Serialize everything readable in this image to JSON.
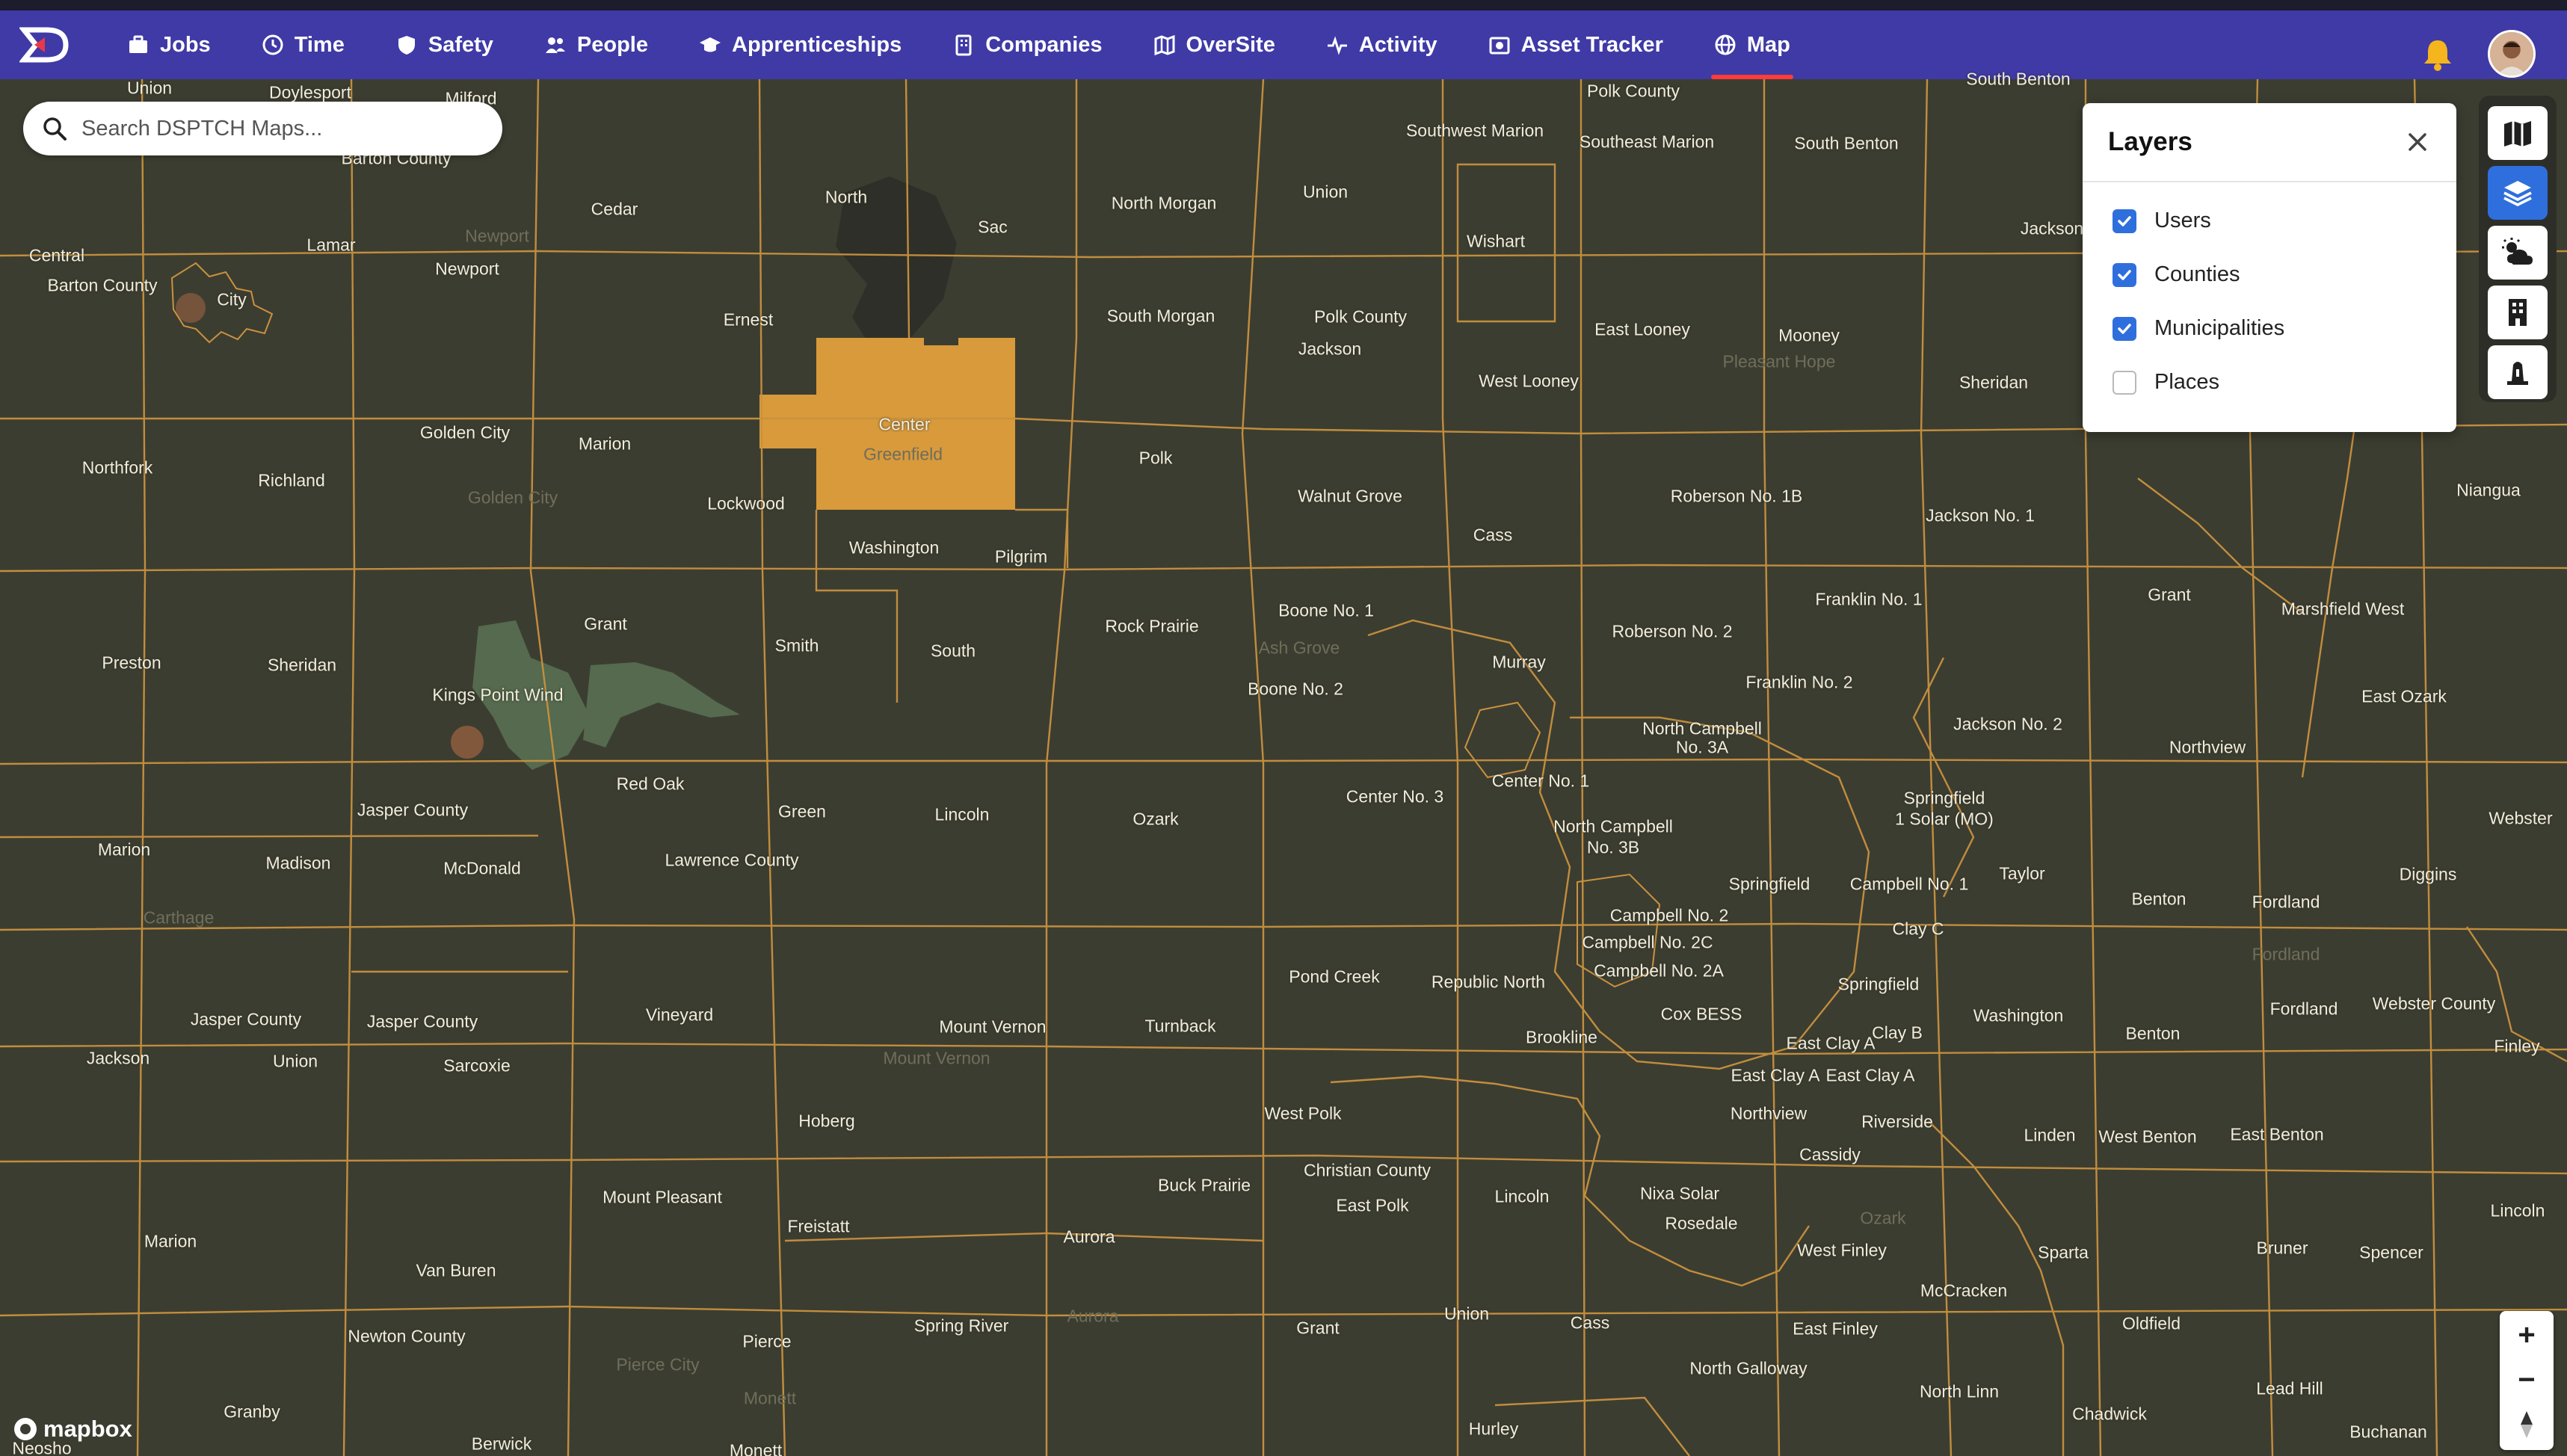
{
  "nav": {
    "items": [
      {
        "label": "Jobs",
        "icon": "briefcase-icon"
      },
      {
        "label": "Time",
        "icon": "clock-icon"
      },
      {
        "label": "Safety",
        "icon": "shield-icon"
      },
      {
        "label": "People",
        "icon": "people-icon"
      },
      {
        "label": "Apprenticeships",
        "icon": "graduation-cap-icon"
      },
      {
        "label": "Companies",
        "icon": "building-icon"
      },
      {
        "label": "OverSite",
        "icon": "map-book-icon"
      },
      {
        "label": "Activity",
        "icon": "pulse-icon"
      },
      {
        "label": "Asset Tracker",
        "icon": "camera-box-icon"
      },
      {
        "label": "Map",
        "icon": "globe-icon",
        "active": true
      }
    ]
  },
  "search": {
    "placeholder": "Search DSPTCH Maps..."
  },
  "layers_panel": {
    "title": "Layers",
    "items": [
      {
        "label": "Users",
        "checked": true
      },
      {
        "label": "Counties",
        "checked": true
      },
      {
        "label": "Municipalities",
        "checked": true
      },
      {
        "label": "Places",
        "checked": false
      }
    ]
  },
  "map": {
    "attribution": "mapbox",
    "colors": {
      "background": "#3c3d31",
      "boundary": "#c9923e",
      "highlight": "#d99a3c",
      "label": "#f1eddc"
    },
    "highlighted_region": "Center",
    "labels": [
      [
        "Union",
        200,
        118
      ],
      [
        "Doylesport",
        415,
        124
      ],
      [
        "Milford",
        630,
        132
      ],
      [
        "Polk County",
        2185,
        122
      ],
      [
        "South Benton",
        2700,
        106
      ],
      [
        "Barton County",
        530,
        212
      ],
      [
        "Southwest Marion",
        1973,
        175
      ],
      [
        "Southeast Marion",
        2203,
        190
      ],
      [
        "South Benton",
        2470,
        192
      ],
      [
        "Cedar",
        822,
        280
      ],
      [
        "North",
        1132,
        264
      ],
      [
        "Union",
        1773,
        257
      ],
      [
        "North Morgan",
        1557,
        272
      ],
      [
        "Sac",
        1328,
        304
      ],
      [
        "Central",
        76,
        342
      ],
      [
        "Lamar",
        443,
        328
      ],
      [
        "Newport",
        665,
        316
      ],
      [
        "Wishart",
        2001,
        323
      ],
      [
        "Jackson",
        2745,
        306
      ],
      [
        "Barton County",
        137,
        382
      ],
      [
        "City",
        310,
        401
      ],
      [
        "Newport",
        625,
        360
      ],
      [
        "Ernest",
        1001,
        428
      ],
      [
        "South Morgan",
        1553,
        423
      ],
      [
        "Polk County",
        1820,
        424
      ],
      [
        "East Looney",
        2197,
        441
      ],
      [
        "Mooney",
        2420,
        449
      ],
      [
        "Pleasant Hope",
        2380,
        484
      ],
      [
        "Jackson",
        1779,
        467
      ],
      [
        "Center",
        1210,
        568
      ],
      [
        "Greenfield",
        1208,
        608
      ],
      [
        "West Looney",
        2045,
        510
      ],
      [
        "Sheridan",
        2667,
        512
      ],
      [
        "Golden City",
        622,
        579
      ],
      [
        "Marion",
        809,
        594
      ],
      [
        "Northfork",
        157,
        626
      ],
      [
        "Richland",
        390,
        643
      ],
      [
        "Polk",
        1546,
        613
      ],
      [
        "Golden City",
        686,
        666
      ],
      [
        "Walnut Grove",
        1806,
        664
      ],
      [
        "Roberson No. 1B",
        2323,
        664
      ],
      [
        "Jackson No. 1",
        2649,
        690
      ],
      [
        "Niangua",
        3329,
        656
      ],
      [
        "Lockwood",
        998,
        674
      ],
      [
        "Cass",
        1997,
        716
      ],
      [
        "Washington",
        1196,
        733
      ],
      [
        "Pilgrim",
        1366,
        745
      ],
      [
        "Grant",
        810,
        835
      ],
      [
        "Franklin No. 1",
        2500,
        802
      ],
      [
        "Grant",
        2902,
        796
      ],
      [
        "Marshfield West",
        3134,
        815
      ],
      [
        "Boone No. 1",
        1774,
        817
      ],
      [
        "Ash Grove",
        1738,
        867
      ],
      [
        "Rock Prairie",
        1541,
        838
      ],
      [
        "Roberson No. 2",
        2237,
        845
      ],
      [
        "Preston",
        176,
        887
      ],
      [
        "Sheridan",
        404,
        890
      ],
      [
        "Smith",
        1066,
        864
      ],
      [
        "South",
        1275,
        871
      ],
      [
        "Murray",
        2032,
        886
      ],
      [
        "Kings Point Wind",
        666,
        930
      ],
      [
        "Boone No. 2",
        1733,
        922
      ],
      [
        "Franklin No. 2",
        2407,
        913
      ],
      [
        "East Ozark",
        3216,
        932
      ],
      [
        "North Campbell",
        2277,
        975
      ],
      [
        "No. 3A",
        2277,
        1000
      ],
      [
        "Jackson No. 2",
        2686,
        969
      ],
      [
        "Northview",
        2953,
        1000
      ],
      [
        "Center No. 1",
        2061,
        1045
      ],
      [
        "Springfield",
        2601,
        1068
      ],
      [
        "Red Oak",
        870,
        1049
      ],
      [
        "Center No. 3",
        1866,
        1066
      ],
      [
        "1 Solar (MO)",
        2601,
        1096
      ],
      [
        "Webster",
        3372,
        1095
      ],
      [
        "Jasper County",
        552,
        1084
      ],
      [
        "Green",
        1073,
        1086
      ],
      [
        "Lincoln",
        1287,
        1090
      ],
      [
        "Ozark",
        1546,
        1096
      ],
      [
        "North Campbell",
        2158,
        1106
      ],
      [
        "No. 3B",
        2158,
        1134
      ],
      [
        "Marion",
        166,
        1137
      ],
      [
        "Madison",
        399,
        1155
      ],
      [
        "McDonald",
        645,
        1162
      ],
      [
        "Lawrence County",
        979,
        1151
      ],
      [
        "Springfield",
        2367,
        1183
      ],
      [
        "Campbell No. 1",
        2554,
        1183
      ],
      [
        "Taylor",
        2705,
        1169
      ],
      [
        "Diggins",
        3248,
        1170
      ],
      [
        "Benton",
        2888,
        1203
      ],
      [
        "Fordland",
        3058,
        1207
      ],
      [
        "Carthage",
        239,
        1228
      ],
      [
        "Campbell No. 2",
        2233,
        1225
      ],
      [
        "Clay C",
        2566,
        1243
      ],
      [
        "Campbell No. 2C",
        2204,
        1261
      ],
      [
        "Fordland",
        3058,
        1277
      ],
      [
        "Campbell No. 2A",
        2219,
        1299
      ],
      [
        "Pond Creek",
        1785,
        1307
      ],
      [
        "Republic North",
        1991,
        1314
      ],
      [
        "Springfield",
        2513,
        1317
      ],
      [
        "Jasper County",
        329,
        1364
      ],
      [
        "Jasper County",
        565,
        1367
      ],
      [
        "Vineyard",
        909,
        1358
      ],
      [
        "Mount Vernon",
        1328,
        1374
      ],
      [
        "Turnback",
        1579,
        1373
      ],
      [
        "Brookline",
        2089,
        1388
      ],
      [
        "Cox BESS",
        2276,
        1357
      ],
      [
        "Clay B",
        2538,
        1382
      ],
      [
        "Washington",
        2700,
        1359
      ],
      [
        "Fordland",
        3082,
        1350
      ],
      [
        "Webster County",
        3256,
        1343
      ],
      [
        "Finley",
        3367,
        1400
      ],
      [
        "Jackson",
        158,
        1416
      ],
      [
        "Union",
        395,
        1420
      ],
      [
        "Sarcoxie",
        638,
        1426
      ],
      [
        "Mount Vernon",
        1253,
        1416
      ],
      [
        "East Clay A",
        2449,
        1396
      ],
      [
        "Benton",
        2880,
        1383
      ],
      [
        "East Clay A",
        2375,
        1439
      ],
      [
        "East Clay A",
        2502,
        1439
      ],
      [
        "Hoberg",
        1106,
        1500
      ],
      [
        "West Polk",
        1743,
        1490
      ],
      [
        "Northview",
        2366,
        1490
      ],
      [
        "Riverside",
        2538,
        1501
      ],
      [
        "Linden",
        2742,
        1519
      ],
      [
        "West Benton",
        2873,
        1521
      ],
      [
        "East Benton",
        3046,
        1518
      ],
      [
        "Cassidy",
        2448,
        1545
      ],
      [
        "Christian County",
        1829,
        1566
      ],
      [
        "Buck Prairie",
        1611,
        1586
      ],
      [
        "Mount Pleasant",
        886,
        1602
      ],
      [
        "East Polk",
        1836,
        1613
      ],
      [
        "Lincoln",
        2036,
        1601
      ],
      [
        "Nixa Solar",
        2247,
        1597
      ],
      [
        "Lincoln",
        3368,
        1620
      ],
      [
        "Freistatt",
        1095,
        1641
      ],
      [
        "Rosedale",
        2276,
        1637
      ],
      [
        "Ozark",
        2519,
        1630
      ],
      [
        "Aurora",
        1457,
        1655
      ],
      [
        "Marion",
        228,
        1661
      ],
      [
        "West Finley",
        2464,
        1673
      ],
      [
        "Sparta",
        2760,
        1676
      ],
      [
        "Bruner",
        3053,
        1670
      ],
      [
        "Spencer",
        3199,
        1676
      ],
      [
        "Van Buren",
        610,
        1700
      ],
      [
        "McCracken",
        2627,
        1727
      ],
      [
        "Aurora",
        1462,
        1761
      ],
      [
        "Spring River",
        1286,
        1774
      ],
      [
        "Grant",
        1763,
        1777
      ],
      [
        "Union",
        1962,
        1758
      ],
      [
        "Cass",
        2127,
        1770
      ],
      [
        "East Finley",
        2455,
        1778
      ],
      [
        "Oldfield",
        2878,
        1771
      ],
      [
        "Newton County",
        544,
        1788
      ],
      [
        "Pierce",
        1026,
        1795
      ],
      [
        "Pierce City",
        880,
        1826
      ],
      [
        "North Galloway",
        2339,
        1831
      ],
      [
        "North Linn",
        2621,
        1862
      ],
      [
        "Lead Hill",
        3063,
        1858
      ],
      [
        "Monett",
        1030,
        1871
      ],
      [
        "Granby",
        337,
        1889
      ],
      [
        "Chadwick",
        2822,
        1892
      ],
      [
        "Hurley",
        1998,
        1912
      ],
      [
        "Buchanan",
        3195,
        1916
      ],
      [
        "Berwick",
        671,
        1932
      ],
      [
        "Monett",
        1011,
        1941
      ],
      [
        "Neosho",
        56,
        1938
      ]
    ],
    "faint_labels": [
      "Newport",
      "Golden City",
      "Greenfield",
      "Pleasant Hope",
      "Ash Grove",
      "Carthage",
      "Mount Vernon",
      "Fordland",
      "Ozark",
      "Aurora",
      "Pierce City",
      "Monett",
      "Monett"
    ]
  },
  "toolbar": {
    "buttons": [
      {
        "icon": "map-style-icon",
        "active": false
      },
      {
        "icon": "layers-icon",
        "active": true
      },
      {
        "icon": "weather-icon",
        "active": false
      },
      {
        "icon": "building-icon",
        "active": false
      },
      {
        "icon": "beacon-icon",
        "active": false
      }
    ]
  },
  "zoom": {
    "in_label": "+",
    "out_label": "−"
  }
}
